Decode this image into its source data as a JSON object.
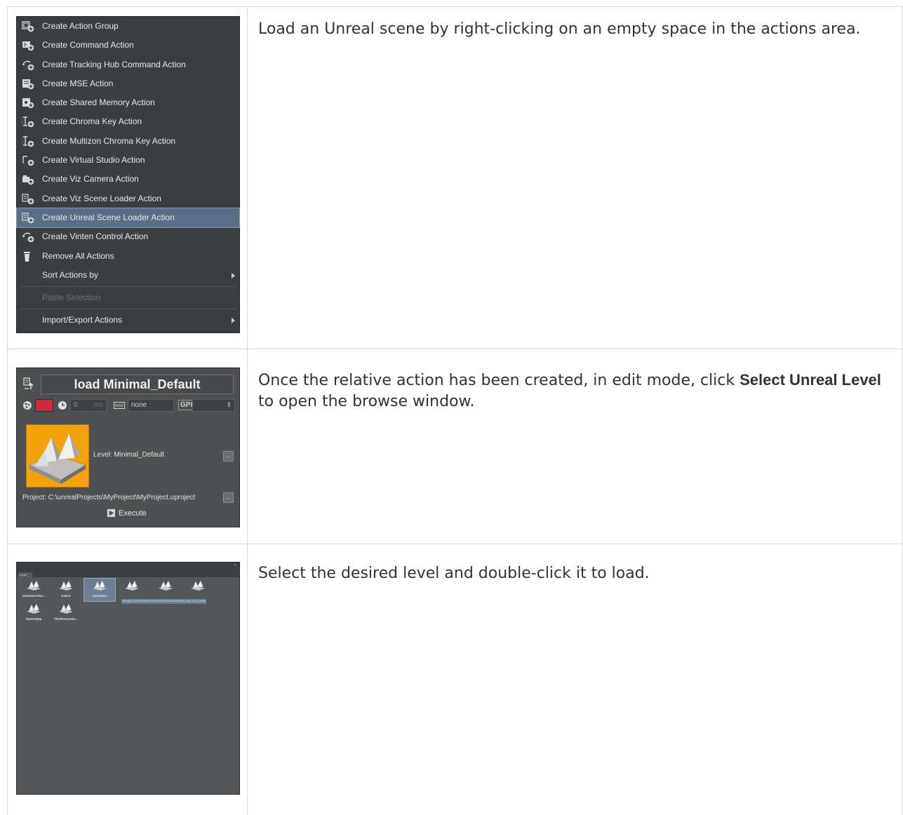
{
  "rows": [
    {
      "description": "Load an Unreal scene by right-clicking on an empty space in the actions area."
    },
    {
      "description_pre": "Once the relative action has been created, in edit mode, click ",
      "description_bold": "Select Unreal Level",
      "description_post": " to open the browse window."
    },
    {
      "description": "Select the desired level and double-click it to load."
    }
  ],
  "context_menu": {
    "items": [
      {
        "label": "Create Action Group",
        "icon": "action-group-icon"
      },
      {
        "label": "Create Command Action",
        "icon": "command-action-icon"
      },
      {
        "label": "Create Tracking Hub Command Action",
        "icon": "tracking-hub-icon"
      },
      {
        "label": "Create MSE Action",
        "icon": "mse-action-icon"
      },
      {
        "label": "Create Shared Memory Action",
        "icon": "shared-memory-icon"
      },
      {
        "label": "Create Chroma Key Action",
        "icon": "chroma-key-icon"
      },
      {
        "label": "Create Multizon Chroma Key Action",
        "icon": "multizon-chroma-key-icon"
      },
      {
        "label": "Create Virtual Studio Action",
        "icon": "virtual-studio-icon"
      },
      {
        "label": "Create Viz Camera Action",
        "icon": "viz-camera-icon"
      },
      {
        "label": "Create Viz Scene Loader Action",
        "icon": "viz-scene-loader-icon"
      },
      {
        "label": "Create Unreal Scene Loader Action",
        "icon": "unreal-scene-loader-icon",
        "highlighted": true
      },
      {
        "label": "Create Vinten Control Action",
        "icon": "vinten-control-icon"
      },
      {
        "label": "Remove All Actions",
        "icon": "trash-icon"
      },
      {
        "label": "Sort Actions by",
        "submenu": true
      },
      {
        "label": "Paste Selection",
        "disabled": true
      },
      {
        "label": "Import/Export Actions",
        "submenu": true
      }
    ],
    "highlight_color": "#5a6f86"
  },
  "action_editor": {
    "title": "load Minimal_Default",
    "color_swatch": "#cc2a3f",
    "delay_value": "0",
    "delay_unit": "ms",
    "trigger_value": "none",
    "gpi_label": "GPI",
    "level_label": "Level:",
    "level_value": "Minimal_Default",
    "project_label": "Project:",
    "project_value": "C:\\unrealProjects\\MyProject\\MyProject.uproject",
    "browse_label": "...",
    "execute_label": "Execute",
    "thumbnail_color": "#f4a20a"
  },
  "level_browser": {
    "tab_label": "Level",
    "close_label": "×",
    "levels": [
      {
        "name": "AnimationTest..."
      },
      {
        "name": "Kallari"
      },
      {
        "name": "Animation",
        "selected": true
      },
      {
        "name": ""
      },
      {
        "name": ""
      },
      {
        "name": ""
      },
      {
        "name": "StarterMap"
      },
      {
        "name": "ThirdPersonEx..."
      }
    ],
    "tooltip": "/Paragon/Yin/Characters/Heroes/Yin/AnimationTestMap.umap",
    "tooltip_suffix": "imal_Default"
  }
}
